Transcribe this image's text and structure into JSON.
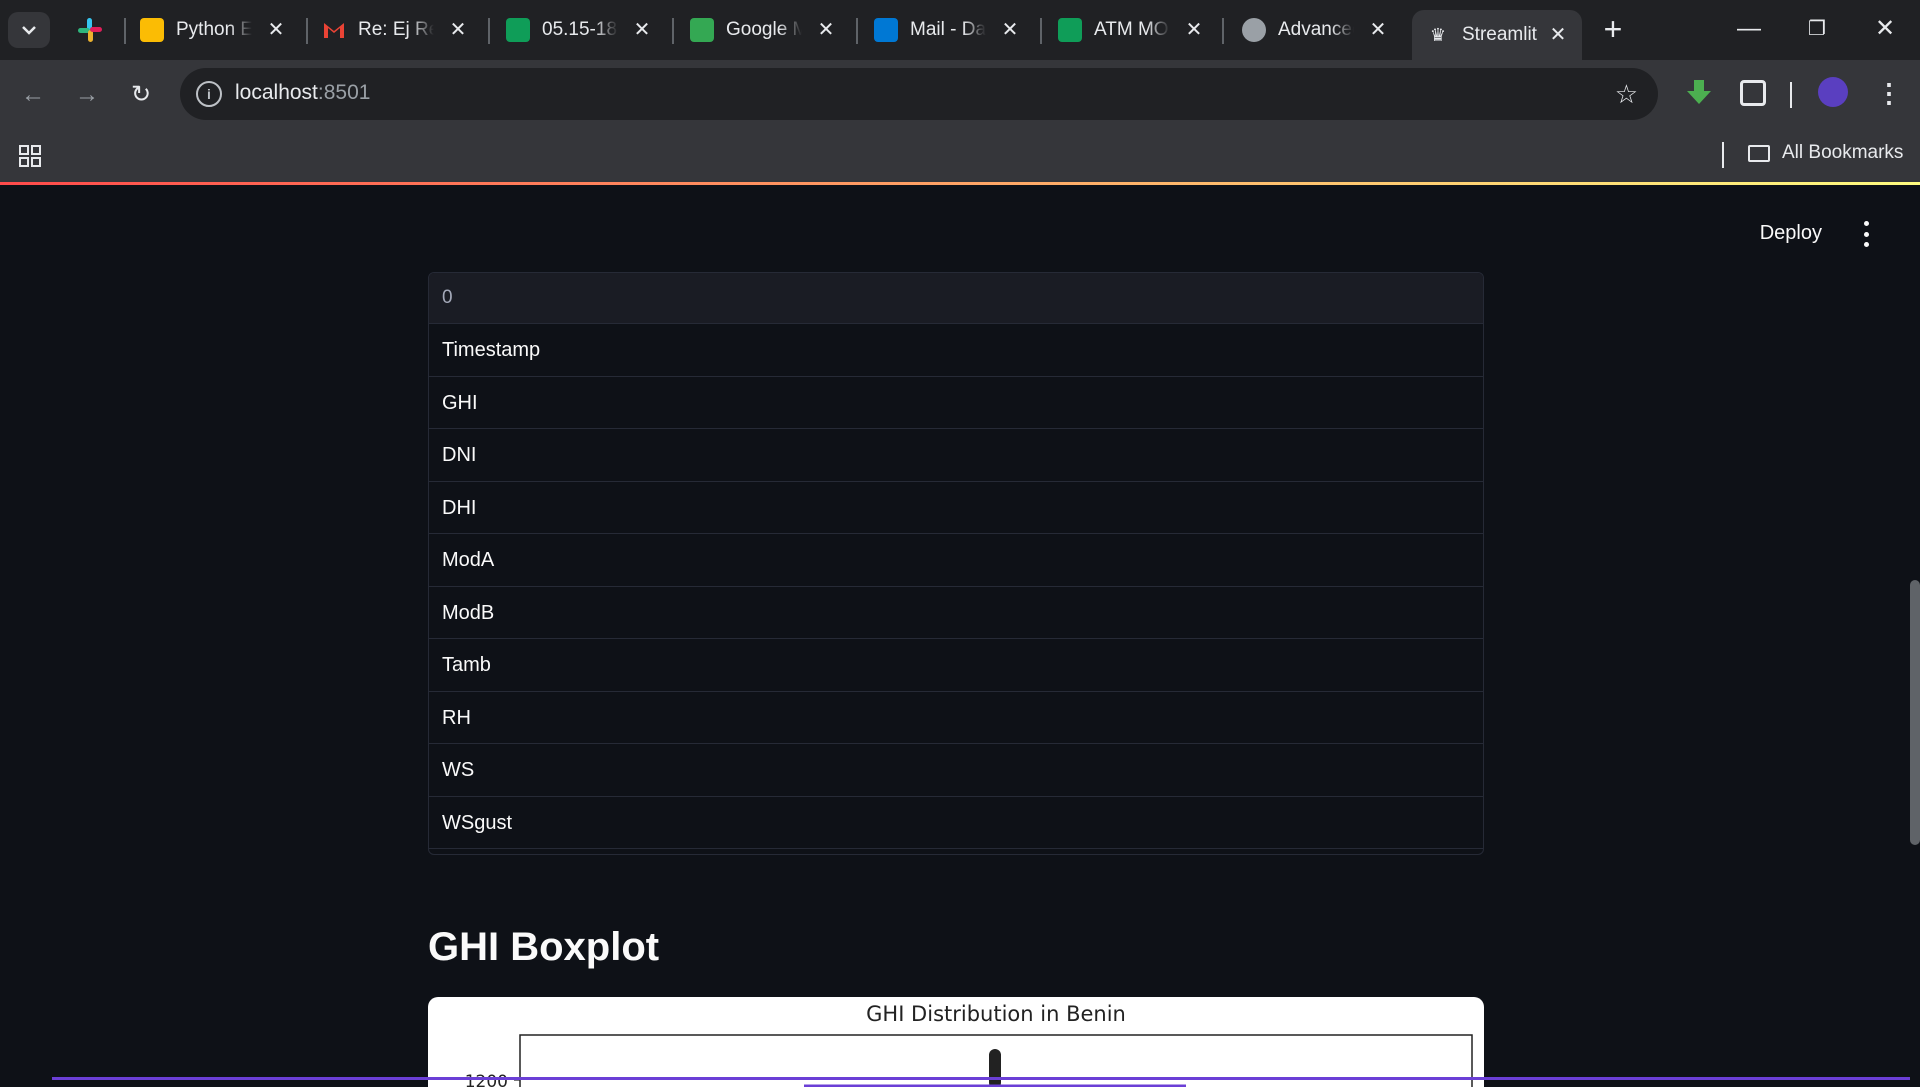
{
  "browser": {
    "tabs": [
      {
        "title": "Python Er",
        "favicon_color": "#fbbc04"
      },
      {
        "title": "Re: Ej Req",
        "favicon_color": "#ea4335"
      },
      {
        "title": "05.15-18.",
        "favicon_color": "#0f9d58"
      },
      {
        "title": "Google M",
        "favicon_color": "#34a853"
      },
      {
        "title": "Mail - Da",
        "favicon_color": "#0078d4"
      },
      {
        "title": "ATM MOI",
        "favicon_color": "#0f9d58"
      },
      {
        "title": "Advancec",
        "favicon_color": "#9aa0a6"
      },
      {
        "title": "Streamlit",
        "favicon_color": "#e8eaed"
      }
    ],
    "url_host": "localhost",
    "url_port": ":8501",
    "all_bookmarks_label": "All Bookmarks"
  },
  "app": {
    "deploy_label": "Deploy",
    "table": {
      "header": "0",
      "rows": [
        "Timestamp",
        "GHI",
        "DNI",
        "DHI",
        "ModA",
        "ModB",
        "Tamb",
        "RH",
        "WS",
        "WSgust"
      ]
    },
    "section_title": "GHI Boxplot"
  },
  "chart_data": {
    "type": "box",
    "title": "GHI Distribution in Benin",
    "yticks": [
      "1200"
    ],
    "visible_ytick": 1200
  },
  "colors": {
    "accent_gradient_start": "#ff4b4b",
    "accent_gradient_end": "#fffd80",
    "box_color": "#6b3fd6"
  }
}
